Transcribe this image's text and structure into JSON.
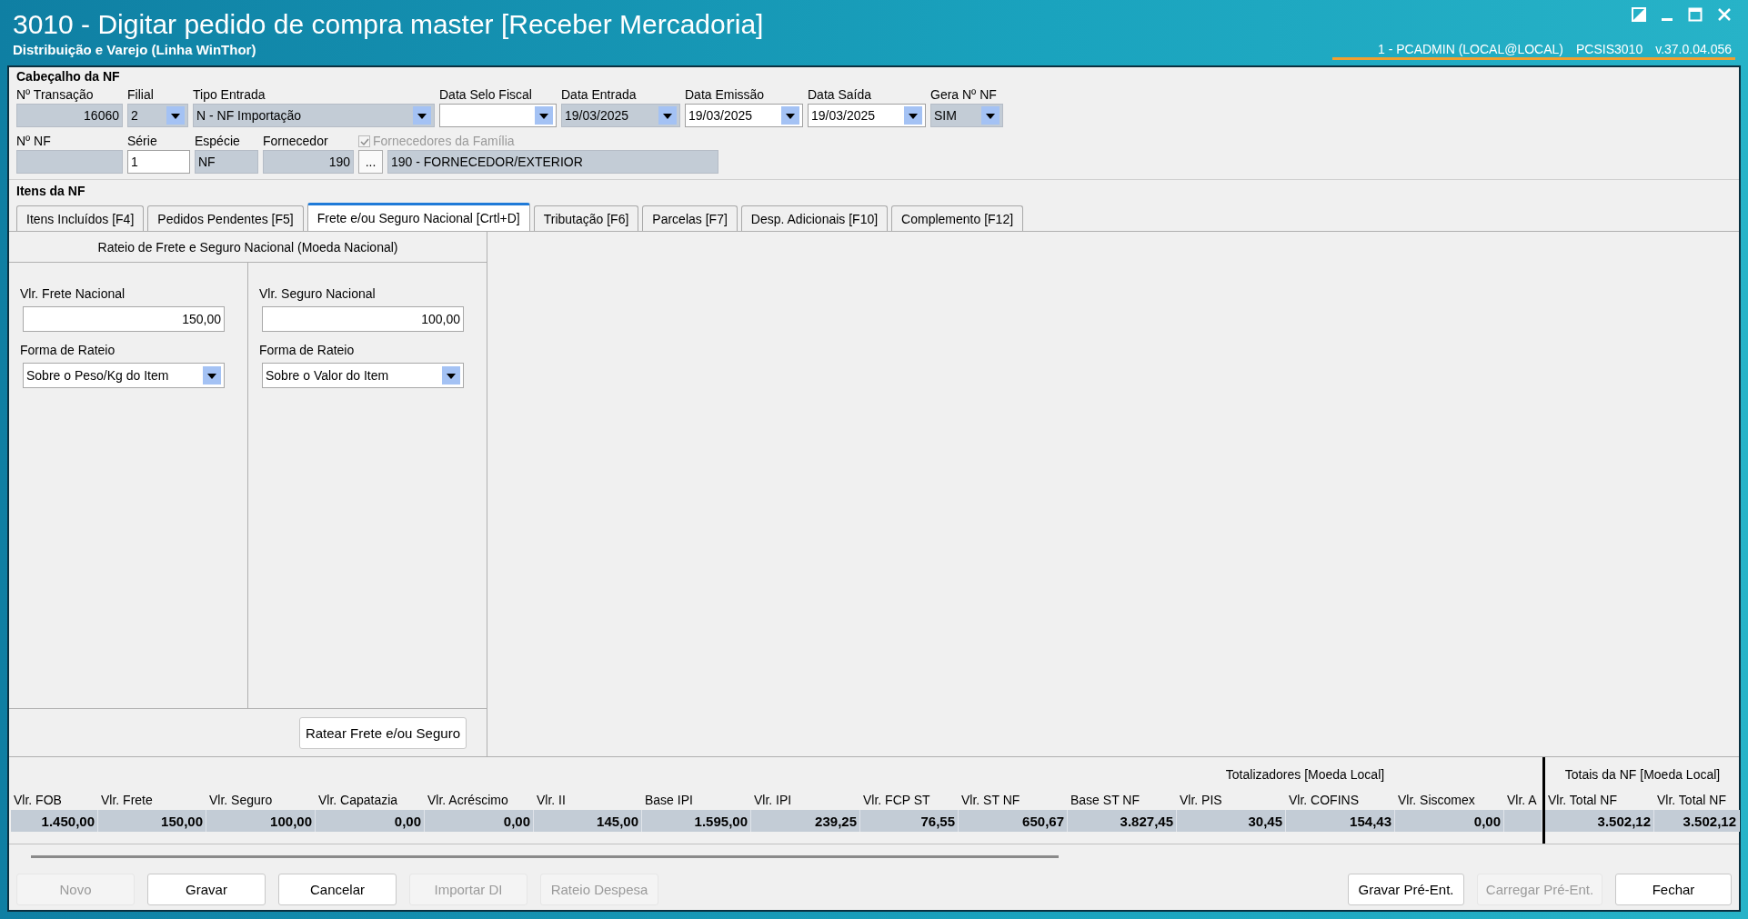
{
  "window": {
    "title": "3010 - Digitar pedido de compra master [Receber Mercadoria]",
    "subtitle": "Distribuição e Varejo (Linha WinThor)",
    "session": "1 - PCADMIN (LOCAL@LOCAL)",
    "program": "PCSIS3010",
    "version": "v.37.0.04.056"
  },
  "header": {
    "title": "Cabeçalho da NF",
    "row1": [
      {
        "kind": "number",
        "label": "Nº Transação",
        "value": "16060",
        "readonly": true
      },
      {
        "kind": "combo",
        "label": "Filial",
        "value": "2",
        "readonly": true
      },
      {
        "kind": "combo",
        "label": "Tipo Entrada",
        "value": "N - NF Importação",
        "readonly": true
      },
      {
        "kind": "combo",
        "label": "Data Selo Fiscal",
        "readonly": false
      },
      {
        "kind": "combo",
        "label": "Data Entrada",
        "value": "19/03/2025",
        "readonly": true
      },
      {
        "kind": "combo",
        "label": "Data Emissão",
        "value": "19/03/2025",
        "readonly": false
      },
      {
        "kind": "combo",
        "label": "Data Saída",
        "value": "19/03/2025",
        "readonly": false
      },
      {
        "kind": "combo",
        "label": "Gera Nº NF",
        "value": "SIM",
        "readonly": true
      }
    ],
    "row2": [
      {
        "kind": "text",
        "label": "Nº NF",
        "readonly": true
      },
      {
        "kind": "text",
        "label": "Série",
        "value": "1",
        "readonly": false
      },
      {
        "kind": "text",
        "label": "Espécie",
        "value": "NF",
        "readonly": true
      },
      {
        "kind": "number",
        "label": "Fornecedor",
        "value": "190",
        "readonly": true
      },
      {
        "kind": "button",
        "checkbox": {
          "label": "Fornecedores da Família",
          "checked": true,
          "disabled": true
        },
        "value": "..."
      },
      {
        "kind": "text",
        "value": "190 - FORNECEDOR/EXTERIOR",
        "readonly": true
      }
    ]
  },
  "items_title": "Itens da NF",
  "tabs": [
    {
      "label": "Itens Incluídos [F4]",
      "selected": false
    },
    {
      "label": "Pedidos Pendentes [F5]",
      "selected": false
    },
    {
      "label": "Frete e/ou Seguro Nacional [Crtl+D]",
      "selected": true
    },
    {
      "label": "Tributação [F6]",
      "selected": false
    },
    {
      "label": "Parcelas [F7]",
      "selected": false
    },
    {
      "label": "Desp. Adicionais [F10]",
      "selected": false
    },
    {
      "label": "Complemento [F12]",
      "selected": false
    }
  ],
  "rateio": {
    "title": "Rateio de Frete e Seguro Nacional (Moeda Nacional)",
    "columns": [
      {
        "label": "Vlr. Frete Nacional",
        "value": "150,00",
        "method_label": "Forma de Rateio",
        "method": "Sobre o Peso/Kg do Item"
      },
      {
        "label": "Vlr. Seguro Nacional",
        "value": "100,00",
        "method_label": "Forma de Rateio",
        "method": "Sobre o Valor do Item"
      }
    ],
    "button": "Ratear Frete e/ou Seguro"
  },
  "totals": [
    {
      "title": "Totalizadores [Moeda Local]",
      "columns": [
        {
          "header": "Vlr. FOB",
          "value": "1.450,00"
        },
        {
          "header": "Vlr. Frete",
          "value": "150,00"
        },
        {
          "header": "Vlr. Seguro",
          "value": "100,00"
        },
        {
          "header": "Vlr. Capatazia",
          "value": "0,00"
        },
        {
          "header": "Vlr. Acréscimo",
          "value": "0,00"
        },
        {
          "header": "Vlr. II",
          "value": "145,00"
        },
        {
          "header": "Base IPI",
          "value": "1.595,00"
        },
        {
          "header": "Vlr. IPI",
          "value": "239,25"
        },
        {
          "header": "Vlr. FCP ST",
          "value": "76,55"
        },
        {
          "header": "Vlr. ST NF",
          "value": "650,67"
        },
        {
          "header": "Base ST NF",
          "value": "3.827,45"
        },
        {
          "header": "Vlr. PIS",
          "value": "30,45"
        },
        {
          "header": "Vlr. COFINS",
          "value": "154,43"
        },
        {
          "header": "Vlr. Siscomex",
          "value": "0,00"
        },
        {
          "header": "Vlr. A"
        }
      ]
    },
    {
      "title": "Totais da NF [Moeda Local]",
      "columns": [
        {
          "header": "Vlr. Total NF",
          "value": "3.502,12"
        },
        {
          "header": "Vlr. Total NF",
          "value": "3.502,12"
        }
      ]
    }
  ],
  "buttons_left": [
    {
      "label": "Novo",
      "disabled": true
    },
    {
      "label": "Gravar",
      "disabled": false
    },
    {
      "label": "Cancelar",
      "disabled": false
    },
    {
      "label": "Importar DI",
      "disabled": true
    },
    {
      "label": "Rateio Despesa",
      "disabled": true
    }
  ],
  "buttons_right": [
    {
      "label": "Gravar Pré-Ent.",
      "disabled": false
    },
    {
      "label": "Carregar Pré-Ent.",
      "disabled": true
    },
    {
      "label": "Fechar",
      "disabled": false
    }
  ]
}
